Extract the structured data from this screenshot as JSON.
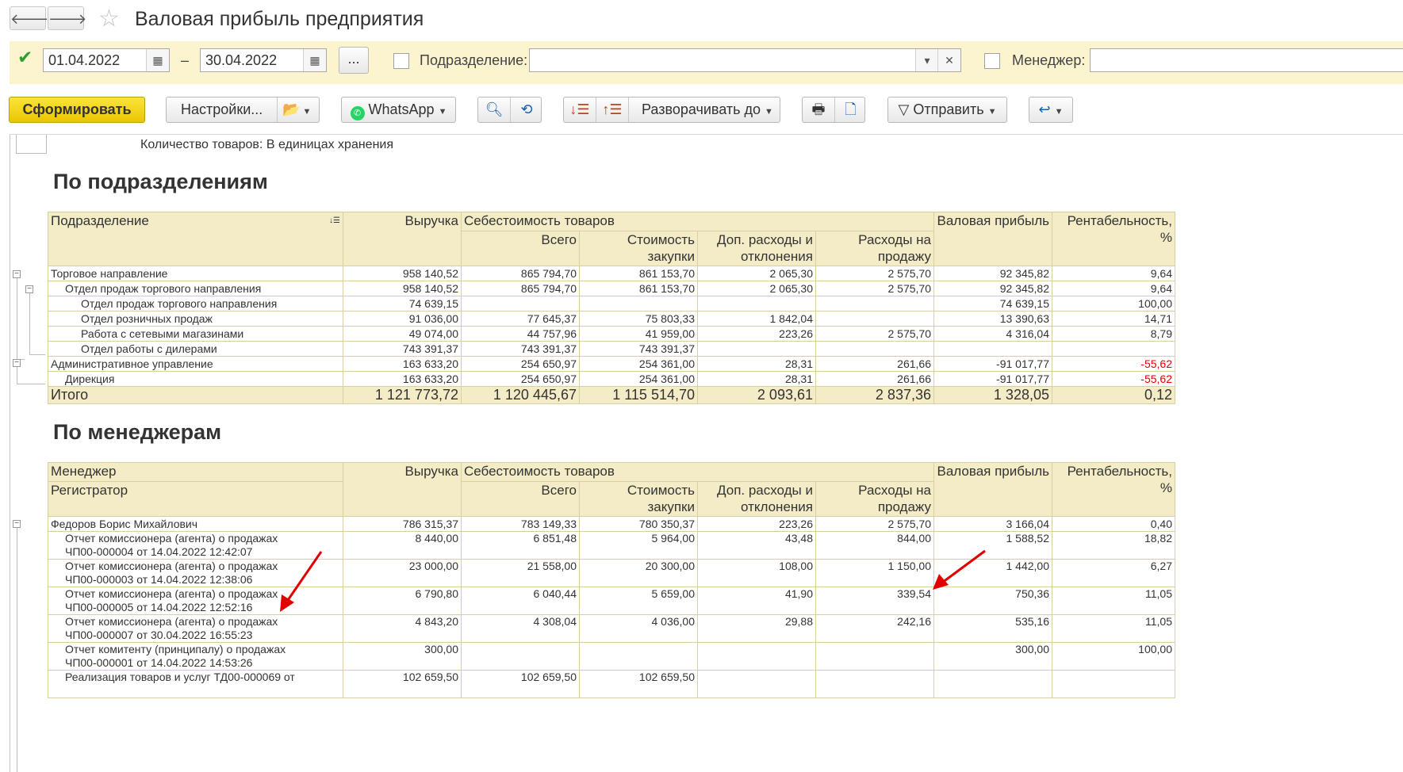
{
  "window": {
    "title": "Валовая прибыль предприятия",
    "back": "🡐",
    "forward": "🡒"
  },
  "filters": {
    "date_from": "01.04.2022",
    "dash": "–",
    "date_to": "30.04.2022",
    "dots_label": "...",
    "subdivision_label": "Подразделение:",
    "manager_label": "Менеджер:"
  },
  "toolbar": {
    "generate": "Сформировать",
    "settings": "Настройки...",
    "whatsapp": "WhatsApp",
    "expand_to": "Разворачивать до",
    "send": "Отправить"
  },
  "report": {
    "quantity_note": "Количество товаров: В единицах хранения",
    "by_subdivisions": {
      "title": "По подразделениям",
      "headers": {
        "col1": "Подразделение",
        "revenue": "Выручка",
        "cost_group": "Себестоимость товаров",
        "total": "Всего",
        "purchase": "Стоимость закупки",
        "extra": "Доп. расходы и отклонения",
        "sale_exp": "Расходы на продажу",
        "gross": "Валовая прибыль",
        "profitability": "Рентабельность, %"
      },
      "rows": [
        [
          "Торговое направление",
          "958 140,52",
          "865 794,70",
          "861 153,70",
          "2 065,30",
          "2 575,70",
          "92 345,82",
          "9,64"
        ],
        [
          "Отдел продаж торгового направления",
          "958 140,52",
          "865 794,70",
          "861 153,70",
          "2 065,30",
          "2 575,70",
          "92 345,82",
          "9,64"
        ],
        [
          "Отдел продаж торгового направления",
          "74 639,15",
          "",
          "",
          "",
          "",
          "74 639,15",
          "100,00"
        ],
        [
          "Отдел розничных продаж",
          "91 036,00",
          "77 645,37",
          "75 803,33",
          "1 842,04",
          "",
          "13 390,63",
          "14,71"
        ],
        [
          "Работа с сетевыми магазинами",
          "49 074,00",
          "44 757,96",
          "41 959,00",
          "223,26",
          "2 575,70",
          "4 316,04",
          "8,79"
        ],
        [
          "Отдел работы с дилерами",
          "743 391,37",
          "743 391,37",
          "743 391,37",
          "",
          "",
          "",
          ""
        ],
        [
          "Административное управление",
          "163 633,20",
          "254 650,97",
          "254 361,00",
          "28,31",
          "261,66",
          "-91 017,77",
          "-55,62"
        ],
        [
          "Дирекция",
          "163 633,20",
          "254 650,97",
          "254 361,00",
          "28,31",
          "261,66",
          "-91 017,77",
          "-55,62"
        ]
      ],
      "total": [
        "Итого",
        "1 121 773,72",
        "1 120 445,67",
        "1 115 514,70",
        "2 093,61",
        "2 837,36",
        "1 328,05",
        "0,12"
      ]
    },
    "by_managers": {
      "title": "По менеджерам",
      "headers": {
        "col1": "Менеджер",
        "col1b": "Регистратор",
        "revenue": "Выручка",
        "cost_group": "Себестоимость товаров",
        "total": "Всего",
        "purchase": "Стоимость закупки",
        "extra": "Доп. расходы и отклонения",
        "sale_exp": "Расходы на продажу",
        "gross": "Валовая прибыль",
        "profitability": "Рентабельность, %"
      },
      "manager_row": [
        "Федоров Борис Михайлович",
        "786 315,37",
        "783 149,33",
        "780 350,37",
        "223,26",
        "2 575,70",
        "3 166,04",
        "0,40"
      ],
      "rows": [
        [
          "Отчет комиссионера (агента) о продажах",
          "ЧП00-000004 от 14.04.2022 12:42:07",
          "8 440,00",
          "6 851,48",
          "5 964,00",
          "43,48",
          "844,00",
          "1 588,52",
          "18,82"
        ],
        [
          "Отчет комиссионера (агента) о продажах",
          "ЧП00-000003 от 14.04.2022 12:38:06",
          "23 000,00",
          "21 558,00",
          "20 300,00",
          "108,00",
          "1 150,00",
          "1 442,00",
          "6,27"
        ],
        [
          "Отчет комиссионера (агента) о продажах",
          "ЧП00-000005 от 14.04.2022 12:52:16",
          "6 790,80",
          "6 040,44",
          "5 659,00",
          "41,90",
          "339,54",
          "750,36",
          "11,05"
        ],
        [
          "Отчет комиссионера (агента) о продажах",
          "ЧП00-000007 от 30.04.2022 16:55:23",
          "4 843,20",
          "4 308,04",
          "4 036,00",
          "29,88",
          "242,16",
          "535,16",
          "11,05"
        ],
        [
          "Отчет комитенту (принципалу) о продажах",
          "ЧП00-000001 от 14.04.2022 14:53:26",
          "300,00",
          "",
          "",
          "",
          "",
          "300,00",
          "100,00"
        ],
        [
          "Реализация товаров и услуг ТД00-000069 от",
          "",
          "102 659,50",
          "102 659,50",
          "102 659,50",
          "",
          "",
          "",
          ""
        ]
      ]
    }
  },
  "colors": {
    "accent_yellow": "#f0d000",
    "header_bg": "#f3ecc7",
    "negative": "#e00000",
    "filter_bg": "#fbf4cf",
    "annotation_arrow": "#e00000"
  }
}
